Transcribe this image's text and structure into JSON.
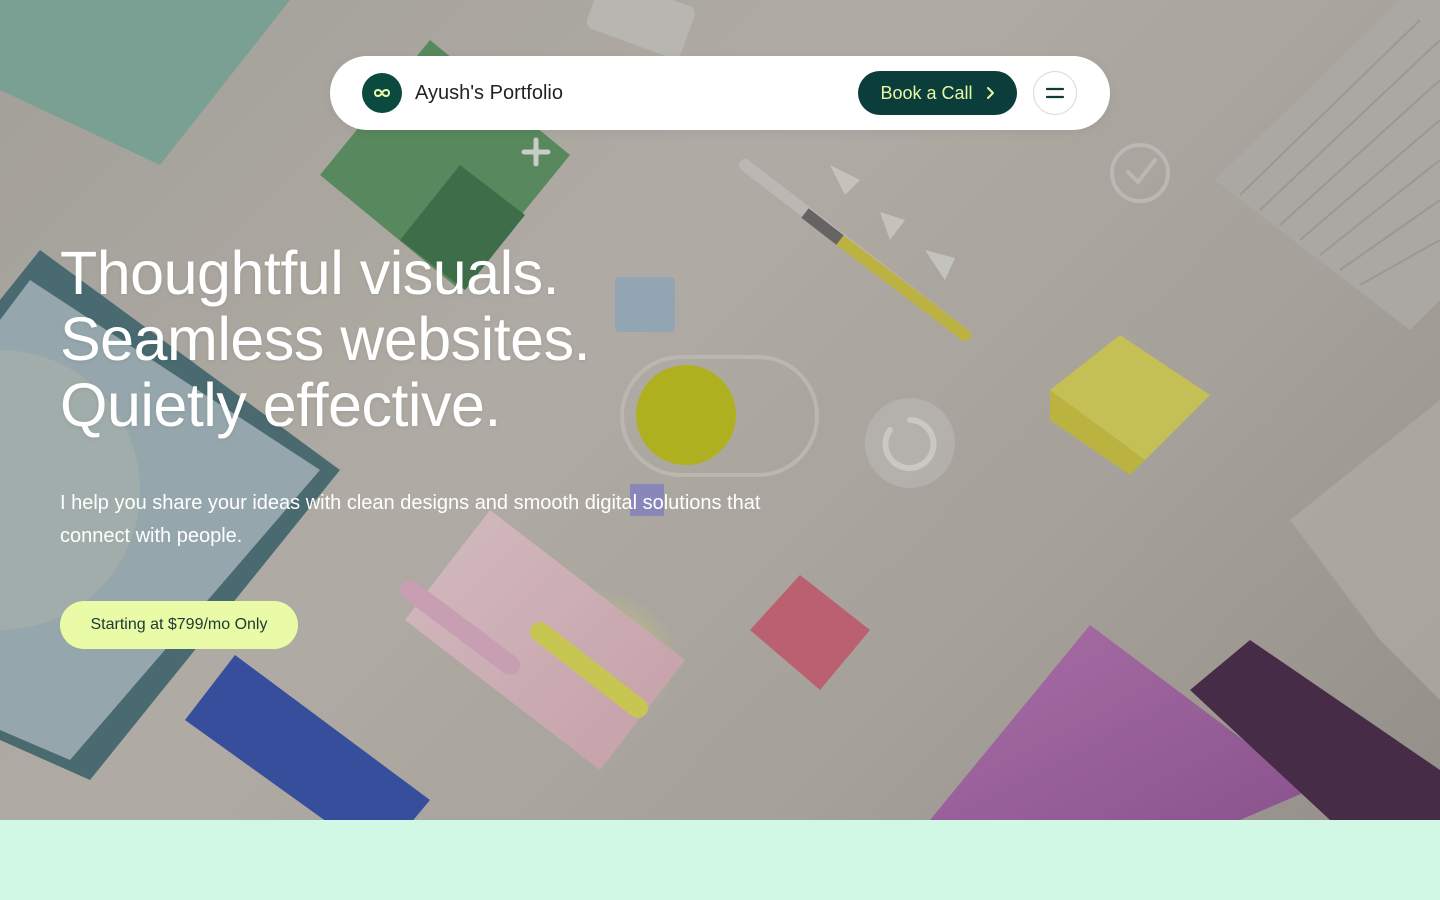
{
  "nav": {
    "brand": "Ayush's Portfolio",
    "cta_label": "Book a Call",
    "logo_icon": "infinity-icon",
    "menu_icon": "hamburger-icon"
  },
  "hero": {
    "headline_lines": [
      "Thoughtful visuals.",
      "Seamless websites.",
      "Quietly effective."
    ],
    "subtext": "I help you share your ideas with clean designs and smooth digital solutions that connect with people.",
    "pricing_cta": "Starting at $799/mo Only"
  },
  "colors": {
    "brand_dark": "#0b3d3a",
    "cta_text": "#e8f7a8",
    "pricing_bg": "#e9fba6",
    "section_bg": "#d1f8e4"
  }
}
